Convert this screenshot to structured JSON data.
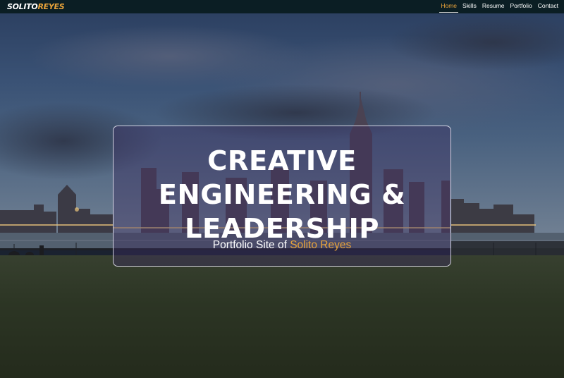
{
  "logo": {
    "first": "SOLITO",
    "last": "REYES"
  },
  "nav": {
    "items": [
      {
        "label": "Home",
        "active": true
      },
      {
        "label": "Skills",
        "active": false
      },
      {
        "label": "Resume",
        "active": false
      },
      {
        "label": "Portfolio",
        "active": false
      },
      {
        "label": "Contact",
        "active": false
      }
    ]
  },
  "hero": {
    "title_lines": [
      "CREATIVE",
      "ENGINEERING &",
      "LEADERSHIP"
    ],
    "subtitle_prefix": "Portfolio Site of ",
    "subtitle_name": "Solito Reyes"
  },
  "colors": {
    "accent": "#e8a33a",
    "navbar_bg": "#0b1e24",
    "text": "#ffffff"
  }
}
